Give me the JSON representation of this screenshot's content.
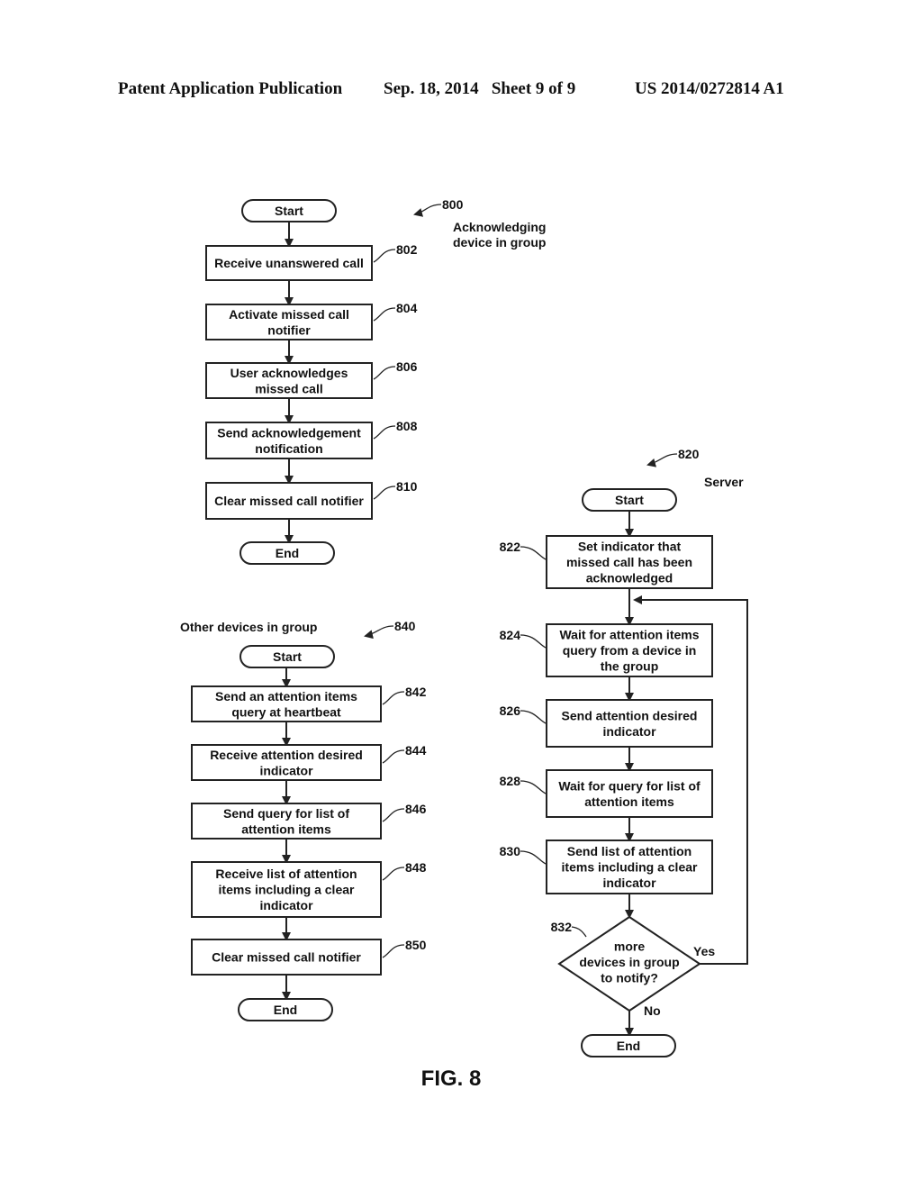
{
  "header": {
    "publication": "Patent Application Publication",
    "date_sheet": "Sep. 18, 2014   Sheet 9 of 9",
    "number": "US 2014/0272814 A1"
  },
  "figure_label": "FIG. 8",
  "flows": {
    "acknowledging": {
      "ref": "800",
      "title_lines": [
        "Acknowledging",
        "device in group"
      ],
      "start": "Start",
      "end": "End",
      "steps": [
        {
          "ref": "802",
          "lines": [
            "Receive unanswered call"
          ]
        },
        {
          "ref": "804",
          "lines": [
            "Activate missed call",
            "notifier"
          ]
        },
        {
          "ref": "806",
          "lines": [
            "User acknowledges",
            "missed call"
          ]
        },
        {
          "ref": "808",
          "lines": [
            "Send acknowledgement",
            "notification"
          ]
        },
        {
          "ref": "810",
          "lines": [
            "Clear missed call notifier"
          ]
        }
      ]
    },
    "server": {
      "ref": "820",
      "title_lines": [
        "Server"
      ],
      "start": "Start",
      "end": "End",
      "steps": [
        {
          "ref": "822",
          "lines": [
            "Set indicator that",
            "missed call has been",
            "acknowledged"
          ]
        },
        {
          "ref": "824",
          "lines": [
            "Wait for attention items",
            "query from a device in",
            "the group"
          ]
        },
        {
          "ref": "826",
          "lines": [
            "Send attention desired",
            "indicator"
          ]
        },
        {
          "ref": "828",
          "lines": [
            "Wait for query for list of",
            "attention items"
          ]
        },
        {
          "ref": "830",
          "lines": [
            "Send list of attention",
            "items including a clear",
            "indicator"
          ]
        }
      ],
      "decision": {
        "ref": "832",
        "lines": [
          "more",
          "devices in group",
          "to notify?"
        ],
        "yes_label": "Yes",
        "no_label": "No"
      }
    },
    "other_devices": {
      "ref": "840",
      "title_lines": [
        "Other devices in group"
      ],
      "start": "Start",
      "end": "End",
      "steps": [
        {
          "ref": "842",
          "lines": [
            "Send an attention items",
            "query at heartbeat"
          ]
        },
        {
          "ref": "844",
          "lines": [
            "Receive attention desired",
            "indicator"
          ]
        },
        {
          "ref": "846",
          "lines": [
            "Send query for list of",
            "attention items"
          ]
        },
        {
          "ref": "848",
          "lines": [
            "Receive list of attention",
            "items including a clear",
            "indicator"
          ]
        },
        {
          "ref": "850",
          "lines": [
            "Clear missed call notifier"
          ]
        }
      ]
    }
  }
}
